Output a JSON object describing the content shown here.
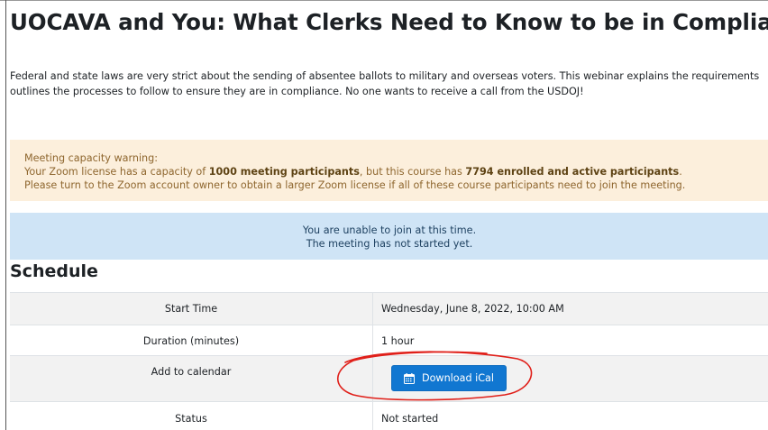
{
  "page": {
    "title": "UOCAVA and You: What Clerks Need to Know to be in Compliance",
    "intro_line1": "Federal and state laws are very strict about the sending of absentee ballots to military and overseas voters. This webinar explains the requirements",
    "intro_line2": "outlines the processes to follow to ensure they are in compliance. No one wants to receive a call from the USDOJ!"
  },
  "warning": {
    "heading": "Meeting capacity warning:",
    "line2_prefix": "Your Zoom license has a capacity of ",
    "line2_capacity": "1000 meeting participants",
    "line2_middle": ", but this course has ",
    "line2_enrolled": "7794 enrolled and active participants",
    "line2_suffix": ".",
    "line3": "Please turn to the Zoom account owner to obtain a larger Zoom license if all of these course participants need to join the meeting."
  },
  "info": {
    "line1": "You are unable to join at this time.",
    "line2": "The meeting has not started yet."
  },
  "schedule": {
    "heading": "Schedule",
    "start_label": "Start Time",
    "start_value": "Wednesday, June 8, 2022, 10:00 AM",
    "duration_label": "Duration (minutes)",
    "duration_value": "1 hour",
    "calendar_label": "Add to calendar",
    "ical_button": "Download iCal",
    "status_label": "Status",
    "status_value": "Not started"
  },
  "colors": {
    "button_blue": "#1177d1",
    "warning_bg": "#fcefdc",
    "info_bg": "#cfe4f6",
    "annotation_red": "#e0201a"
  },
  "icons": {
    "calendar": "calendar-icon"
  }
}
